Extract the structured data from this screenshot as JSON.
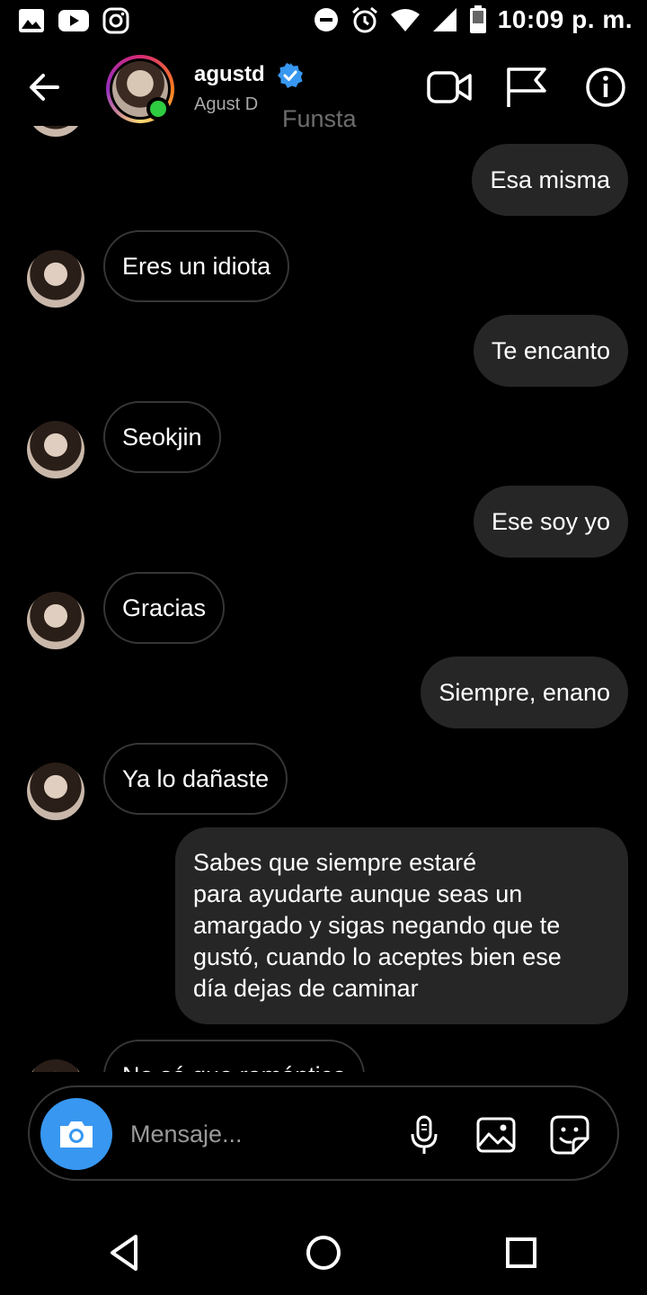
{
  "status_bar": {
    "time": "10:09 p. m.",
    "left_icons": [
      "gallery-icon",
      "youtube-icon",
      "instagram-icon"
    ],
    "right_icons": [
      "dnd-icon",
      "alarm-icon",
      "wifi-icon",
      "signal-icon",
      "battery-icon"
    ]
  },
  "header": {
    "username": "agustd",
    "subtitle": "Agust D",
    "overlay_text": "Funsta",
    "verified": true,
    "online": true,
    "icons": [
      "back-arrow-icon",
      "video-call-icon",
      "flag-icon",
      "info-icon"
    ]
  },
  "messages": [
    {
      "side": "out",
      "text": "Esa misma"
    },
    {
      "side": "in",
      "text": "Eres un idiota"
    },
    {
      "side": "out",
      "text": "Te encanto"
    },
    {
      "side": "in",
      "text": "Seokjin"
    },
    {
      "side": "out",
      "text": "Ese soy yo"
    },
    {
      "side": "in",
      "text": "Gracias"
    },
    {
      "side": "out",
      "text": "Siempre, enano"
    },
    {
      "side": "in",
      "text": "Ya lo dañaste"
    },
    {
      "side": "out",
      "text": "Sabes que siempre estaré\npara ayudarte aunque seas un\namargado y sigas negando que te\ngustó, cuando lo aceptes bien ese\ndía dejas de caminar"
    },
    {
      "side": "in",
      "text": "No sé que romántico"
    }
  ],
  "composer": {
    "placeholder": "Mensaje...",
    "icons": [
      "camera-icon",
      "microphone-icon",
      "image-icon",
      "sticker-icon"
    ]
  },
  "nav": {
    "buttons": [
      "back-triangle-icon",
      "home-circle-icon",
      "recents-square-icon"
    ]
  },
  "colors": {
    "background": "#000000",
    "bubble_out": "#262626",
    "bubble_in_border": "#363636",
    "camera_button": "#3897f0",
    "online": "#2ecc40",
    "verified": "#3897f0"
  }
}
